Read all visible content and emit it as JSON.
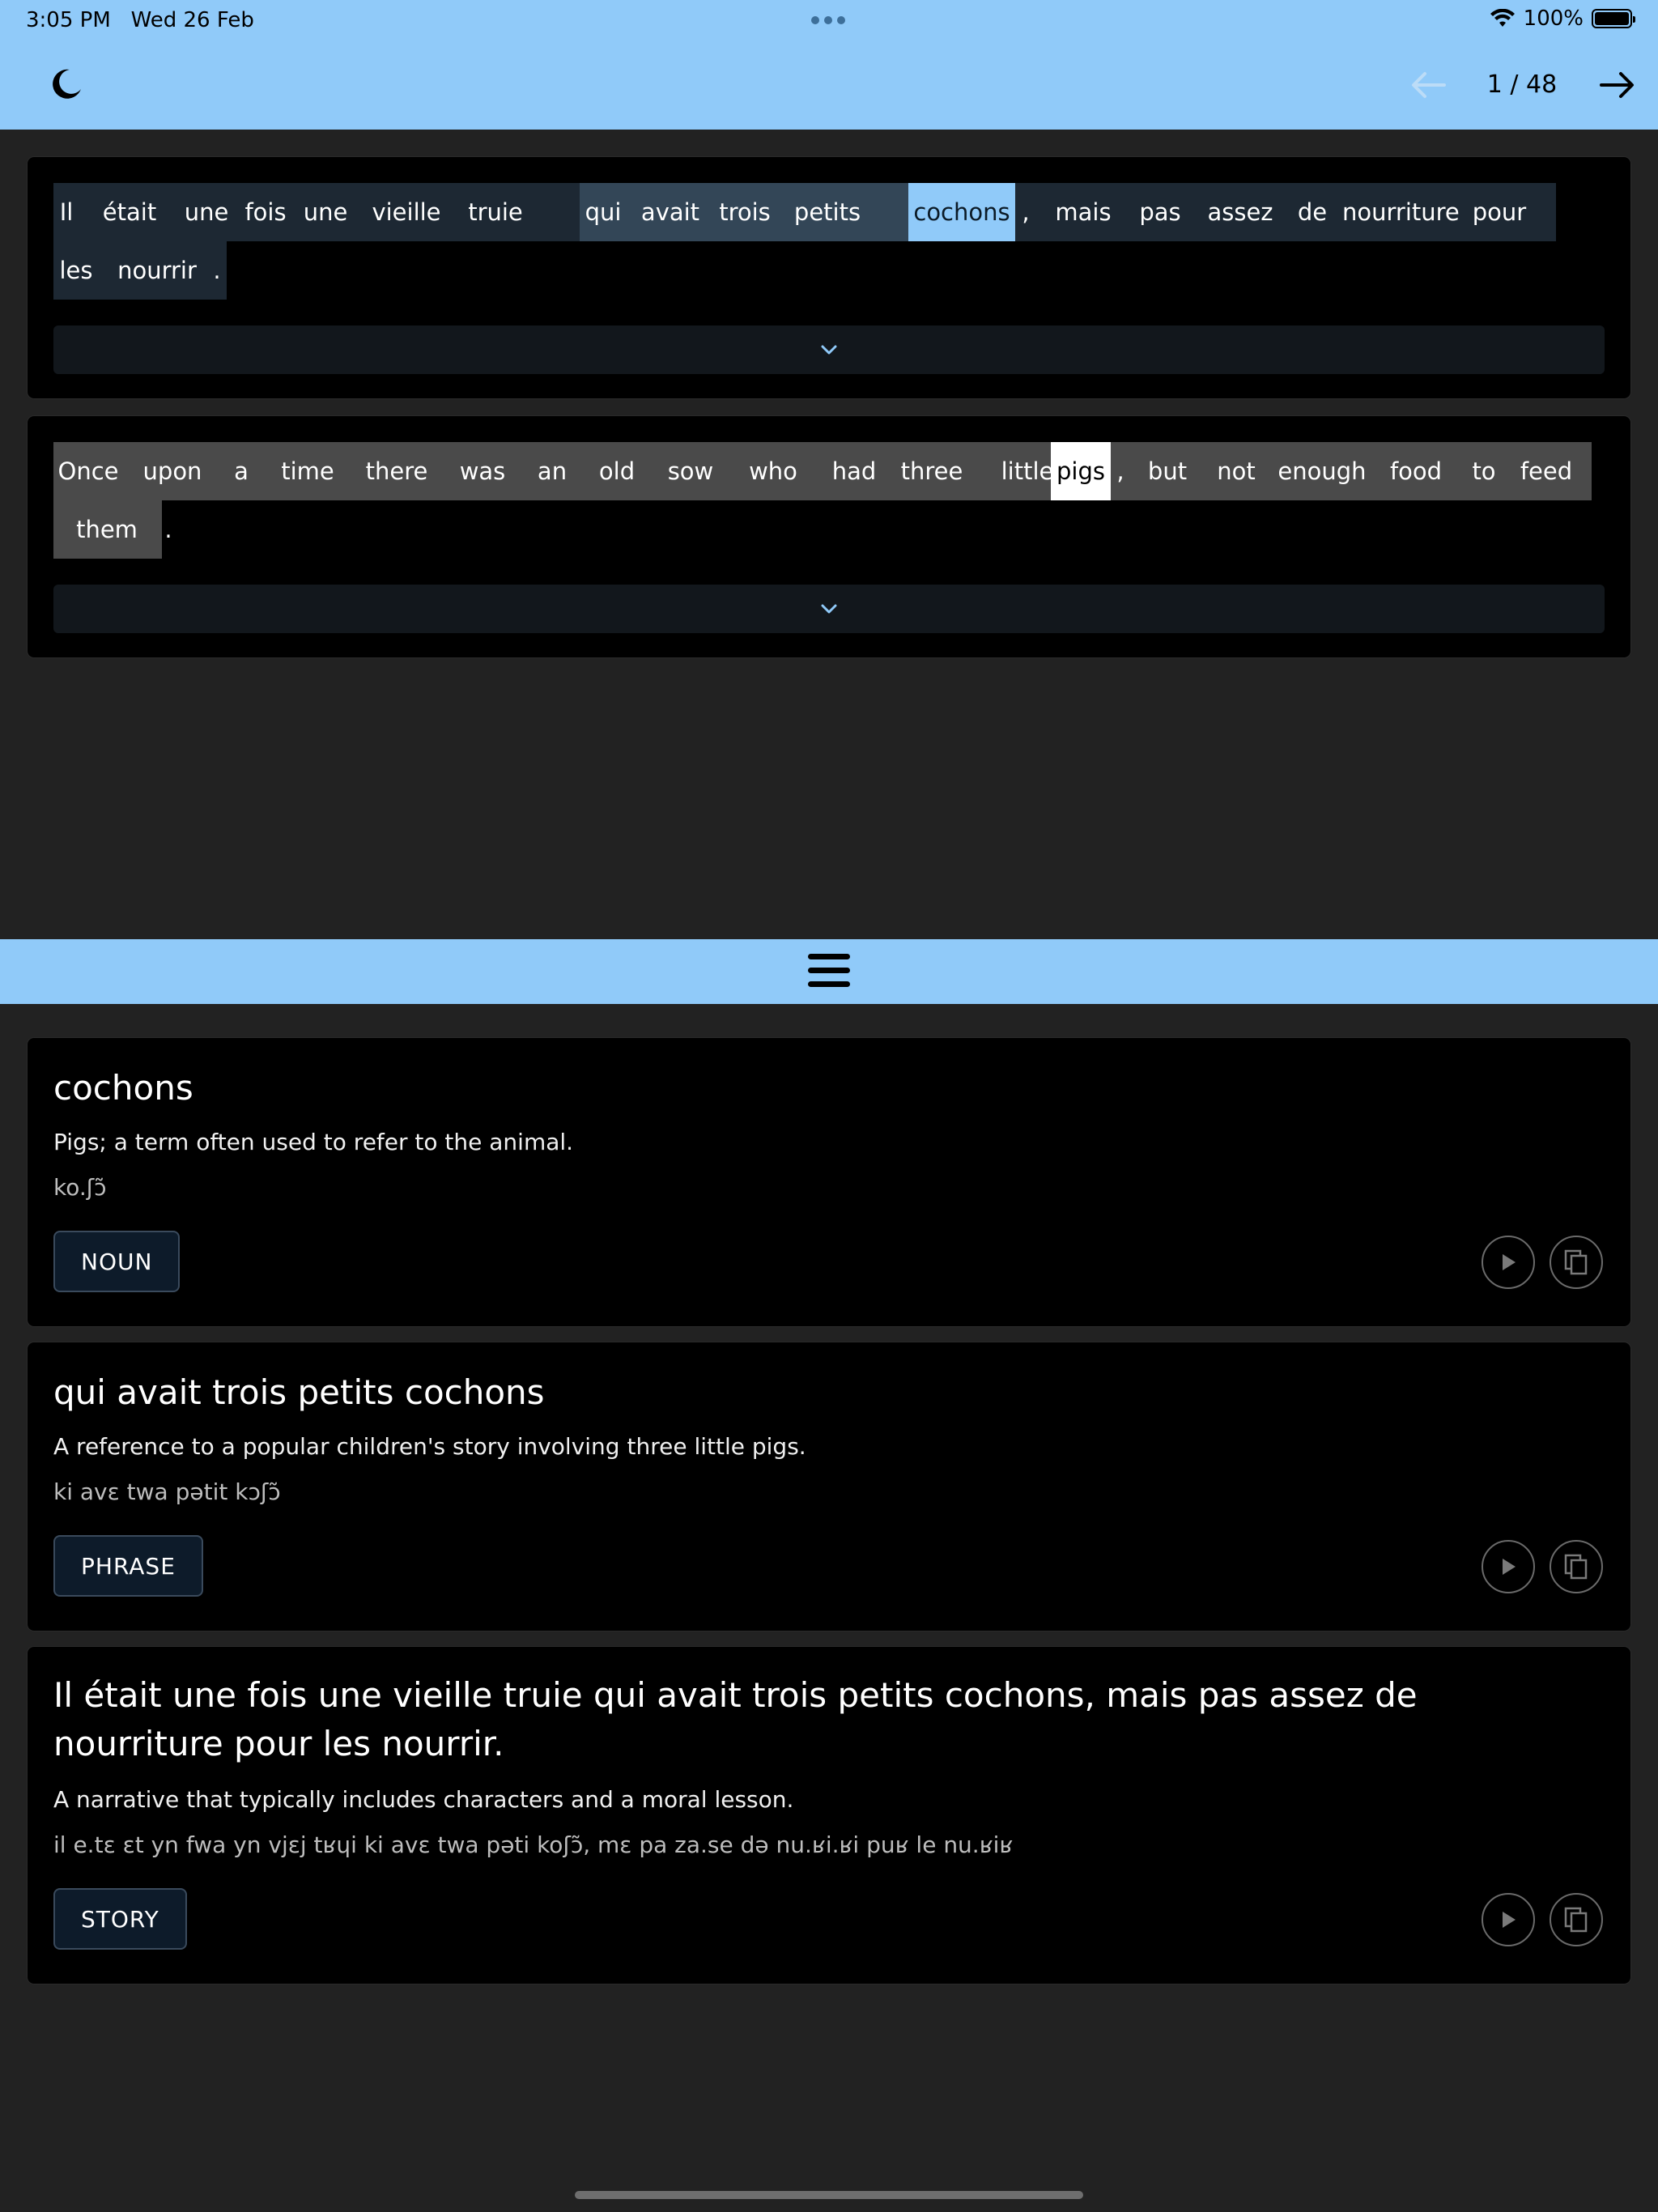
{
  "status_bar": {
    "time": "3:05 PM",
    "date": "Wed 26 Feb",
    "battery": "100%",
    "battery_level": 1.0
  },
  "header": {
    "page_indicator": "1 / 48"
  },
  "source_sentence": {
    "tokens": [
      "Il",
      "était",
      "une",
      "fois",
      "une",
      "vieille",
      "truie",
      "qui",
      "avait",
      "trois",
      "petits",
      "cochons",
      ",",
      "mais",
      "pas",
      "assez",
      "de",
      "nourriture",
      "pour",
      "les",
      "nourrir",
      "."
    ]
  },
  "target_sentence": {
    "tokens": [
      "Once",
      "upon",
      "a",
      "time",
      "there",
      "was",
      "an",
      "old",
      "sow",
      "who",
      "had",
      "three",
      "little",
      "pigs",
      ",",
      "but",
      "not",
      "enough",
      "food",
      "to",
      "feed",
      "them",
      "."
    ]
  },
  "definitions": [
    {
      "term": "cochons",
      "description": "Pigs; a term often used to refer to the animal.",
      "ipa": "ko.ʃɔ̃",
      "badge": "NOUN"
    },
    {
      "term": "qui avait trois petits cochons",
      "description": "A reference to a popular children's story involving three little pigs.",
      "ipa": "ki avɛ twa pətit kɔʃɔ̃",
      "badge": "PHRASE"
    },
    {
      "term": "Il était une fois une vieille truie qui avait trois petits cochons, mais pas assez de nourriture pour les nourrir.",
      "description": "A narrative that typically includes characters and a moral lesson.",
      "ipa": "il e.tɛ ɛt yn fwa yn vjɛj tʁɥi ki avɛ twa pəti koʃɔ̃, mɛ pa za.se də nu.ʁi.ʁi puʁ le nu.ʁiʁ",
      "badge": "STORY"
    }
  ],
  "colors": {
    "accent": "#90caf9",
    "background": "#222222",
    "card": "#000000",
    "source_sentence_bg": "#1d2833",
    "phrase_highlight": "#334657",
    "selected_word_fr": "#90caf9",
    "target_sentence_bg": "#4a4a4a",
    "selected_word_en": "#ffffff"
  },
  "icons": {
    "theme_toggle": "moon-icon",
    "previous": "arrow-left-icon",
    "next": "arrow-right-icon",
    "expand": "chevron-down-icon",
    "panel_handle": "hamburger-icon",
    "play": "play-icon",
    "copy": "copy-icon"
  }
}
